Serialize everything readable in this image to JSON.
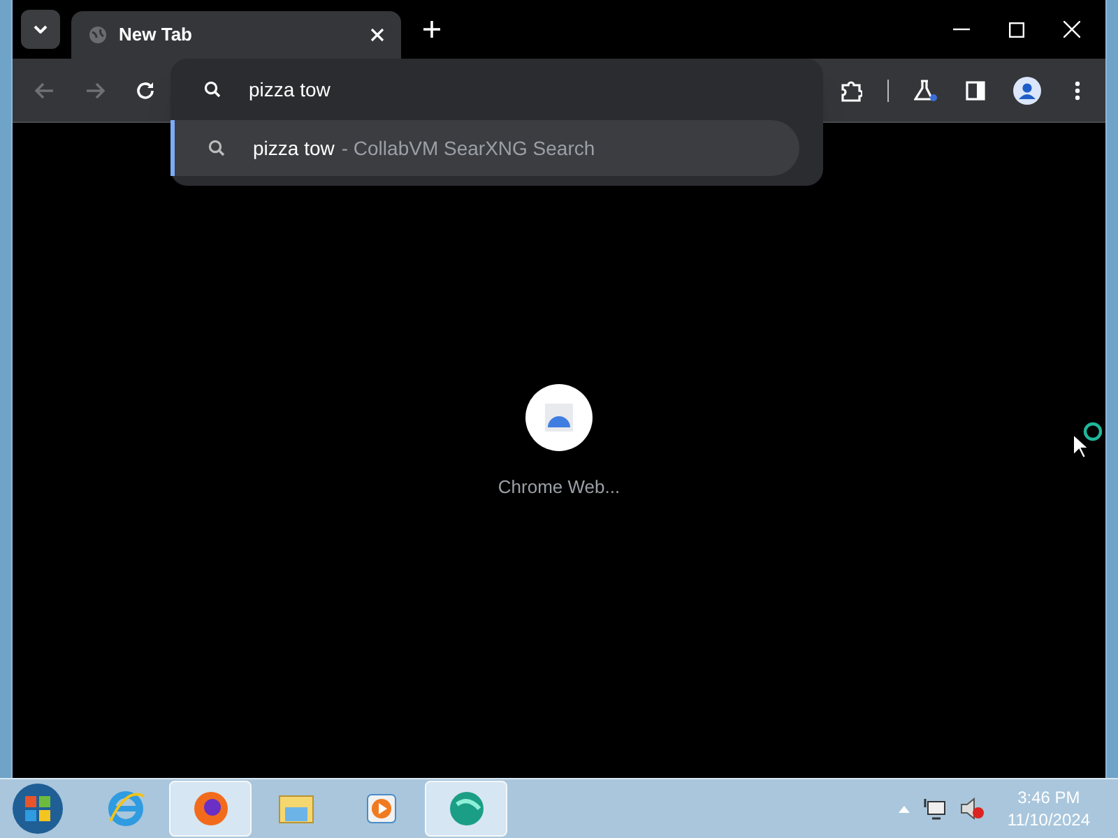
{
  "tab": {
    "title": "New Tab"
  },
  "omnibox": {
    "value": "pizza tow",
    "suggestion": {
      "query": "pizza tow",
      "source": "- CollabVM SearXNG Search",
      "selected": true
    }
  },
  "shortcut": {
    "label": "Chrome Web..."
  },
  "taskbar": {
    "apps": [
      {
        "kind": "ie",
        "open": false
      },
      {
        "kind": "firefox",
        "open": true
      },
      {
        "kind": "explorer",
        "open": false
      },
      {
        "kind": "media",
        "open": false
      },
      {
        "kind": "collab",
        "open": true
      }
    ],
    "time": "3:46 PM",
    "date": "11/10/2024"
  }
}
